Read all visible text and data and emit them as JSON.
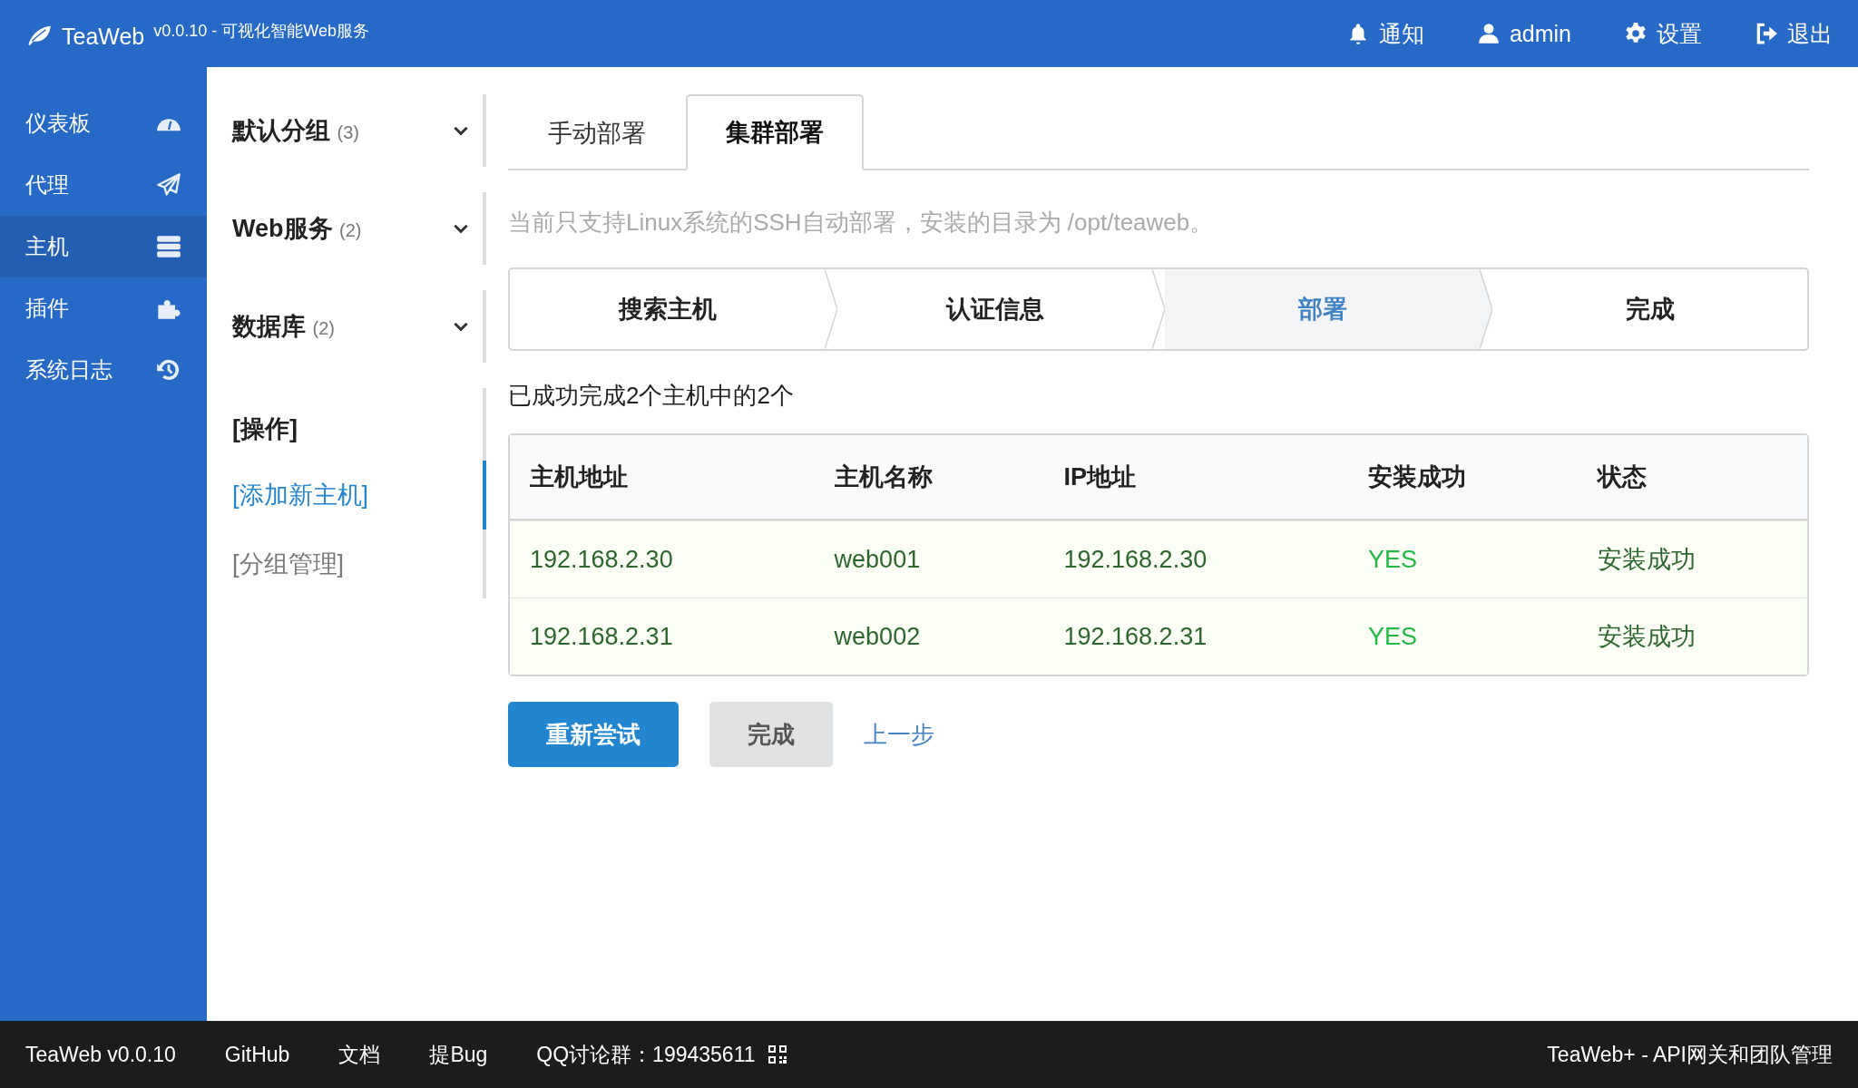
{
  "header": {
    "logo": "TeaWeb",
    "version": "v0.0.10 - 可视化智能Web服务",
    "nav": [
      {
        "label": "通知"
      },
      {
        "label": "admin"
      },
      {
        "label": "设置"
      },
      {
        "label": "退出"
      }
    ]
  },
  "sidebar": {
    "items": [
      {
        "label": "仪表板",
        "selected": false
      },
      {
        "label": "代理",
        "selected": false
      },
      {
        "label": "主机",
        "selected": true
      },
      {
        "label": "插件",
        "selected": false
      },
      {
        "label": "系统日志",
        "selected": false
      }
    ]
  },
  "groups": [
    {
      "name": "默认分组",
      "count": "(3)"
    },
    {
      "name": "Web服务",
      "count": "(2)"
    },
    {
      "name": "数据库",
      "count": "(2)"
    }
  ],
  "operations": {
    "heading": "[操作]",
    "links": [
      {
        "label": "[添加新主机]",
        "selected": true
      },
      {
        "label": "[分组管理]",
        "selected": false
      }
    ]
  },
  "tabs": [
    {
      "label": "手动部署",
      "selected": false
    },
    {
      "label": "集群部署",
      "selected": true
    }
  ],
  "notice": "当前只支持Linux系统的SSH自动部署，安装的目录为 /opt/teaweb。",
  "steps": [
    {
      "label": "搜索主机",
      "selected": false
    },
    {
      "label": "认证信息",
      "selected": false
    },
    {
      "label": "部署",
      "selected": true
    },
    {
      "label": "完成",
      "selected": false
    }
  ],
  "summary": "已成功完成2个主机中的2个",
  "table": {
    "columns": [
      "主机地址",
      "主机名称",
      "IP地址",
      "安装成功",
      "状态"
    ],
    "rows": [
      {
        "positive": true,
        "cells": [
          "192.168.2.30",
          "web001",
          "192.168.2.30",
          "YES",
          "安装成功"
        ]
      },
      {
        "positive": true,
        "cells": [
          "192.168.2.31",
          "web002",
          "192.168.2.31",
          "YES",
          "安装成功"
        ]
      }
    ]
  },
  "buttons": [
    {
      "label": "重新尝试",
      "kind": "primary"
    },
    {
      "label": "完成",
      "kind": "secondary"
    },
    {
      "label": "上一步",
      "kind": "link"
    }
  ],
  "footer": {
    "left": [
      "TeaWeb v0.0.10",
      "GitHub",
      "文档",
      "提Bug"
    ],
    "qq": "QQ讨论群：199435611",
    "right": "TeaWeb+ - API网关和团队管理"
  }
}
